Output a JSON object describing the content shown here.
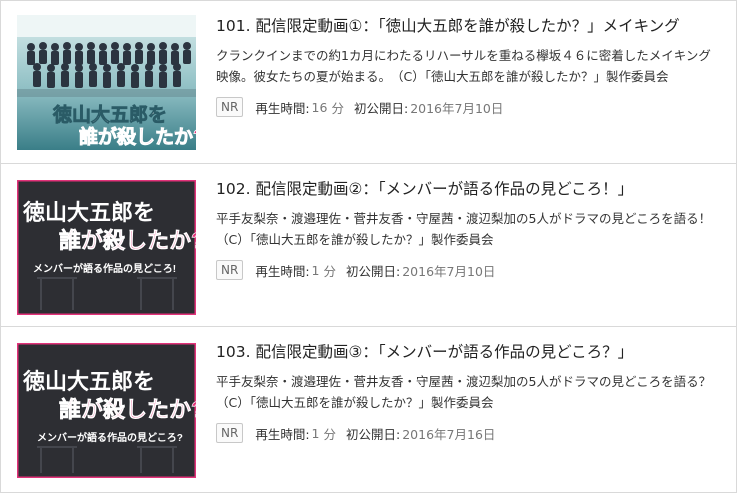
{
  "items": [
    {
      "title": "101. 配信限定動画①：「徳山大五郎を誰が殺したか？」メイキング",
      "desc": "クランクインまでの約1カ月にわたるリハーサルを重ねる欅坂４６に密着したメイキング映像。彼女たちの夏が始まる。　（C）「徳山大五郎を誰が殺したか？」製作委員会",
      "rating": "NR",
      "runtime_label": "再生時間:",
      "runtime_value": "16",
      "runtime_unit": "分",
      "date_label": "初公開日:",
      "date_value": "2016年7月10日",
      "thumb": {
        "line1": "徳山大五郎を",
        "line2": "誰が殺したか?",
        "caption": ""
      }
    },
    {
      "title": "102. 配信限定動画②：「メンバーが語る作品の見どころ！」",
      "desc": "平手友梨奈・渡邉理佐・菅井友香・守屋茜・渡辺梨加の5人がドラマの見どころを語る！　（C）「徳山大五郎を誰が殺したか？」製作委員会",
      "rating": "NR",
      "runtime_label": "再生時間:",
      "runtime_value": "1",
      "runtime_unit": "分",
      "date_label": "初公開日:",
      "date_value": "2016年7月10日",
      "thumb": {
        "line1": "徳山大五郎を",
        "line2": "誰が殺したか?",
        "caption": "メンバーが語る作品の見どころ!"
      }
    },
    {
      "title": "103. 配信限定動画③：「メンバーが語る作品の見どころ？」",
      "desc": "平手友梨奈・渡邉理佐・菅井友香・守屋茜・渡辺梨加の5人がドラマの見どころを語る？　（C）「徳山大五郎を誰が殺したか？」製作委員会",
      "rating": "NR",
      "runtime_label": "再生時間:",
      "runtime_value": "1",
      "runtime_unit": "分",
      "date_label": "初公開日:",
      "date_value": "2016年7月16日",
      "thumb": {
        "line1": "徳山大五郎を",
        "line2": "誰が殺したか?",
        "caption": "メンバーが語る作品の見どころ?"
      }
    }
  ],
  "colors": {
    "pink": "#e3327a",
    "border": "#d9d9d9",
    "muted": "#777777"
  }
}
